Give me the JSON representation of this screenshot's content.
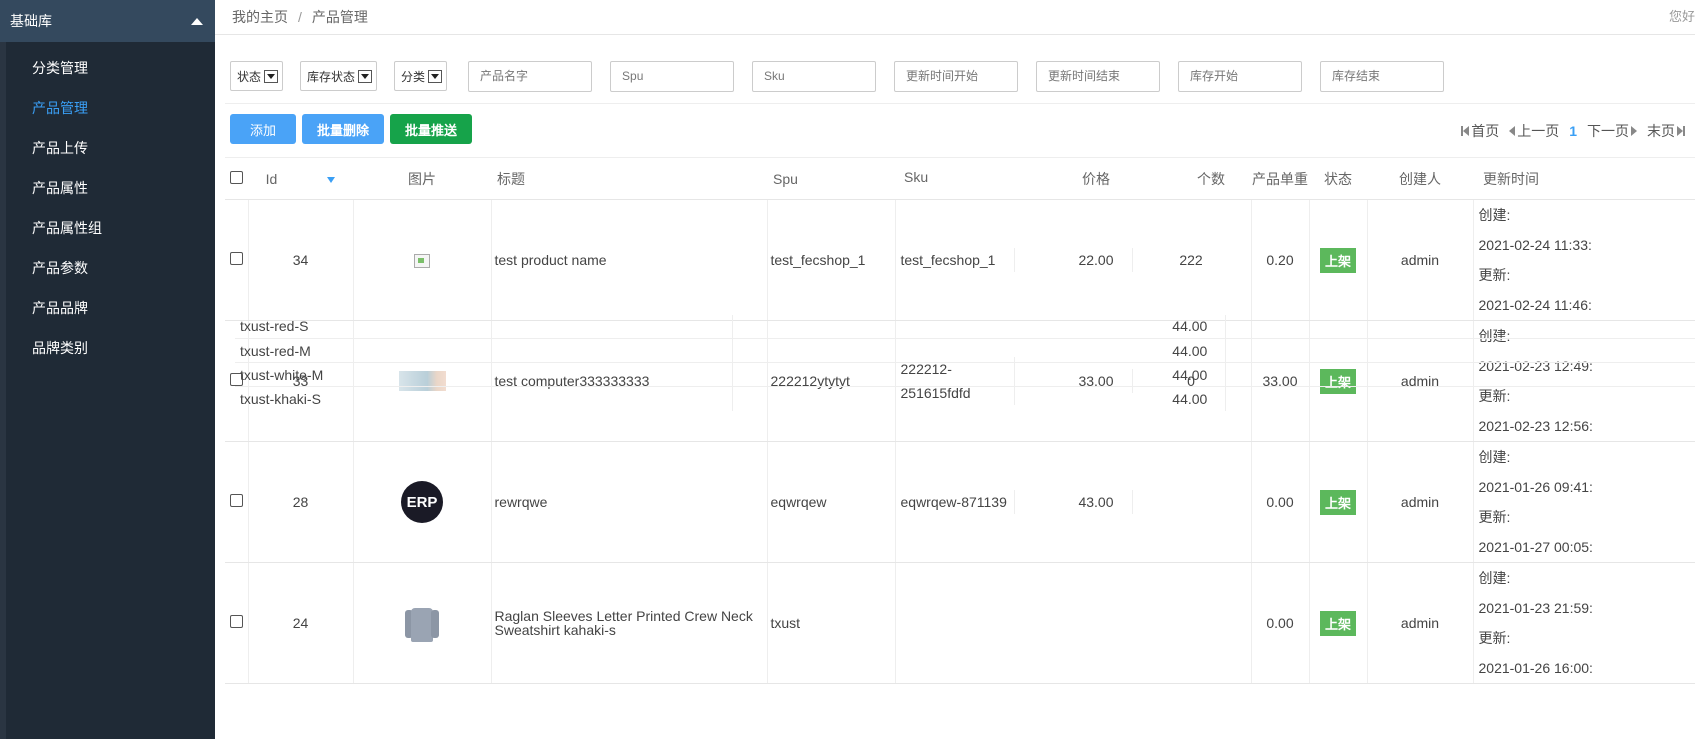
{
  "sidebar": {
    "header": "基础库",
    "items": [
      {
        "label": "分类管理",
        "active": false
      },
      {
        "label": "产品管理",
        "active": true
      },
      {
        "label": "产品上传",
        "active": false
      },
      {
        "label": "产品属性",
        "active": false
      },
      {
        "label": "产品属性组",
        "active": false
      },
      {
        "label": "产品参数",
        "active": false
      },
      {
        "label": "产品品牌",
        "active": false
      },
      {
        "label": "品牌类别",
        "active": false
      }
    ]
  },
  "breadcrumb": {
    "home": "我的主页",
    "separator": "/",
    "current": "产品管理",
    "greeting": "您好"
  },
  "filters": {
    "status": "状态",
    "stock_status": "库存状态",
    "category": "分类",
    "product_name_placeholder": "产品名字",
    "spu_placeholder": "Spu",
    "sku_placeholder": "Sku",
    "updated_start_placeholder": "更新时间开始",
    "updated_end_placeholder": "更新时间结束",
    "stock_start_placeholder": "库存开始",
    "stock_end_placeholder": "库存结束"
  },
  "actions": {
    "add": "添加",
    "batch_delete": "批量删除",
    "batch_push": "批量推送"
  },
  "pager": {
    "first": "首页",
    "prev": "上一页",
    "current": "1",
    "next": "下一页",
    "last": "末页"
  },
  "columns": {
    "id": "Id",
    "image": "图片",
    "title": "标题",
    "spu": "Spu",
    "sku": "Sku",
    "price": "价格",
    "qty": "个数",
    "weight": "产品单重",
    "status": "状态",
    "creator": "创建人",
    "updated": "更新时间"
  },
  "labels": {
    "created": "创建:",
    "updated": "更新:"
  },
  "colors": {
    "sidebar_bg": "#1f2a36",
    "active_link": "#3a9ff5",
    "btn_blue": "#4aa3f7",
    "btn_green": "#16a34a",
    "status_green": "#5cb85c"
  },
  "rows": [
    {
      "id": "34",
      "image": "broken-image-icon",
      "title": "test product name",
      "spu": "test_fecshop_1",
      "skus": [
        {
          "sku": "test_fecshop_1",
          "price": "22.00",
          "qty": "222"
        }
      ],
      "weight": "0.20",
      "status": "上架",
      "creator": "admin",
      "created": "2021-02-24 11:33:",
      "updated": "2021-02-24 11:46:"
    },
    {
      "id": "33",
      "image": "banner-thumbnail",
      "title": "test computer333333333",
      "spu": "222212ytytyt",
      "skus": [
        {
          "sku": "222212-251615fdfd",
          "price": "33.00",
          "qty": "0"
        }
      ],
      "weight": "33.00",
      "status": "上架",
      "creator": "admin",
      "created": "2021-02-23 12:49:",
      "updated": "2021-02-23 12:56:"
    },
    {
      "id": "28",
      "image": "erp-logo",
      "image_text": "ERP",
      "title": "rewrqwe",
      "spu": "eqwrqew",
      "skus": [
        {
          "sku": "eqwrqew-871139",
          "price": "43.00",
          "qty": ""
        }
      ],
      "weight": "0.00",
      "status": "上架",
      "creator": "admin",
      "created": "2021-01-26 09:41:",
      "updated": "2021-01-27 00:05:"
    },
    {
      "id": "24",
      "image": "sweatshirt-thumbnail",
      "title": "Raglan Sleeves Letter Printed Crew Neck Sweatshirt kahaki-s",
      "spu": "txust",
      "skus": [
        {
          "sku": "txust-red-S",
          "price": "44.00",
          "qty": ""
        },
        {
          "sku": "txust-red-M",
          "price": "44.00",
          "qty": ""
        },
        {
          "sku": "txust-white-M",
          "price": "44.00",
          "qty": ""
        },
        {
          "sku": "txust-khaki-S",
          "price": "44.00",
          "qty": ""
        }
      ],
      "weight": "0.00",
      "status": "上架",
      "creator": "admin",
      "created": "2021-01-23 21:59:",
      "updated": "2021-01-26 16:00:"
    }
  ]
}
